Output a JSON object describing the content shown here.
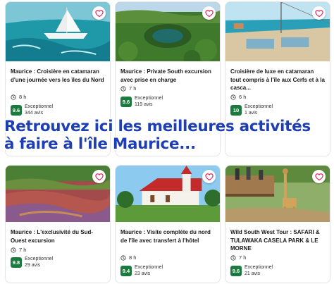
{
  "colors": {
    "rating_badge": "#1b7a3e",
    "banner_text": "#1d3eb5",
    "heart": "#e0245e"
  },
  "banner": {
    "line1": "Retrouvez ici les meilleures activités",
    "line2": "à faire à l'île Maurice..."
  },
  "cards": [
    {
      "title": "Maurice : Croisière en catamaran d'une journée vers les îles du Nord",
      "duration": "8 h",
      "score": "9.6",
      "rating_label": "Exceptionnel",
      "reviews": "344 avis",
      "icon": "heart-icon"
    },
    {
      "title": "Maurice : Private South excursion avec prise en charge",
      "duration": "7 h",
      "score": "9.6",
      "rating_label": "Exceptionnel",
      "reviews": "119 avis",
      "icon": "heart-icon"
    },
    {
      "title": "Croisière de luxe en catamaran tout compris à l'île aux Cerfs et à la casca...",
      "duration": "6 h",
      "score": "10",
      "rating_label": "Exceptionnel",
      "reviews": "1 avis",
      "icon": "heart-icon"
    },
    {
      "title": "Maurice : L'exclusivité du Sud-Ouest excursion",
      "duration": "7 h",
      "score": "9.8",
      "rating_label": "Exceptionnel",
      "reviews": "29 avis",
      "icon": "heart-icon"
    },
    {
      "title": "Maurice : Visite complète du nord de l'île avec transfert à l'hôtel",
      "duration": "8 h",
      "score": "9.4",
      "rating_label": "Exceptionnel",
      "reviews": "23 avis",
      "icon": "heart-icon"
    },
    {
      "title": "Wild South West Tour : SAFARI & TULAWAKA CASELA PARK & LE MORNE",
      "duration": "7 h",
      "score": "9.6",
      "rating_label": "Exceptionnel",
      "reviews": "21 avis",
      "icon": "heart-icon"
    }
  ]
}
